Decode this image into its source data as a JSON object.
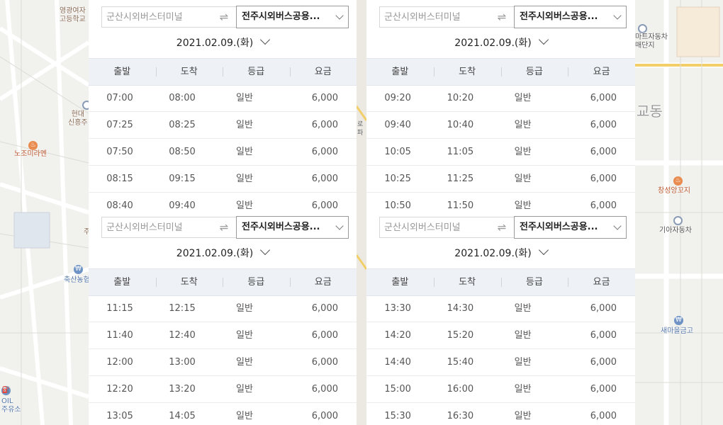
{
  "map": {
    "labels": {
      "a": "영광여자\n고등학교",
      "b": "현대\n신흥주",
      "c": "노조미라멘",
      "d": "축산농협",
      "e": "OIL\n주유소",
      "f": "마트자동차\n매단지",
      "g": "교동",
      "h": "창성앙꼬지",
      "i": "기아자동차",
      "j": "새마을금고",
      "k": "로\n파",
      "l": "주"
    }
  },
  "panels": [
    {
      "origin_placeholder": "군산시외버스터미널",
      "swap_icon": "⇌",
      "destination": "전주시외버스공용...",
      "date": "2021.02.09.(화)",
      "headers": [
        "출발",
        "도착",
        "등급",
        "요금"
      ],
      "rows": [
        [
          "07:00",
          "08:00",
          "일반",
          "6,000"
        ],
        [
          "07:25",
          "08:25",
          "일반",
          "6,000"
        ],
        [
          "07:50",
          "08:50",
          "일반",
          "6,000"
        ],
        [
          "08:15",
          "09:15",
          "일반",
          "6,000"
        ],
        [
          "08:40",
          "09:40",
          "일반",
          "6,000"
        ]
      ]
    },
    {
      "origin_placeholder": "군산시외버스터미널",
      "swap_icon": "⇌",
      "destination": "전주시외버스공용...",
      "date": "2021.02.09.(화)",
      "headers": [
        "출발",
        "도착",
        "등급",
        "요금"
      ],
      "rows": [
        [
          "09:20",
          "10:20",
          "일반",
          "6,000"
        ],
        [
          "09:40",
          "10:40",
          "일반",
          "6,000"
        ],
        [
          "10:05",
          "11:05",
          "일반",
          "6,000"
        ],
        [
          "10:25",
          "11:25",
          "일반",
          "6,000"
        ],
        [
          "10:50",
          "11:50",
          "일반",
          "6,000"
        ]
      ]
    },
    {
      "origin_placeholder": "군산시외버스터미널",
      "swap_icon": "⇌",
      "destination": "전주시외버스공용...",
      "date": "2021.02.09.(화)",
      "headers": [
        "출발",
        "도착",
        "등급",
        "요금"
      ],
      "rows": [
        [
          "11:15",
          "12:15",
          "일반",
          "6,000"
        ],
        [
          "11:40",
          "12:40",
          "일반",
          "6,000"
        ],
        [
          "12:00",
          "13:00",
          "일반",
          "6,000"
        ],
        [
          "12:20",
          "13:20",
          "일반",
          "6,000"
        ],
        [
          "13:05",
          "14:05",
          "일반",
          "6,000"
        ]
      ]
    },
    {
      "origin_placeholder": "군산시외버스터미널",
      "swap_icon": "⇌",
      "destination": "전주시외버스공용...",
      "date": "2021.02.09.(화)",
      "headers": [
        "출발",
        "도착",
        "등급",
        "요금"
      ],
      "rows": [
        [
          "13:30",
          "14:30",
          "일반",
          "6,000"
        ],
        [
          "14:20",
          "15:20",
          "일반",
          "6,000"
        ],
        [
          "14:40",
          "15:40",
          "일반",
          "6,000"
        ],
        [
          "15:00",
          "16:00",
          "일반",
          "6,000"
        ],
        [
          "15:30",
          "16:30",
          "일반",
          "6,000"
        ]
      ]
    }
  ]
}
